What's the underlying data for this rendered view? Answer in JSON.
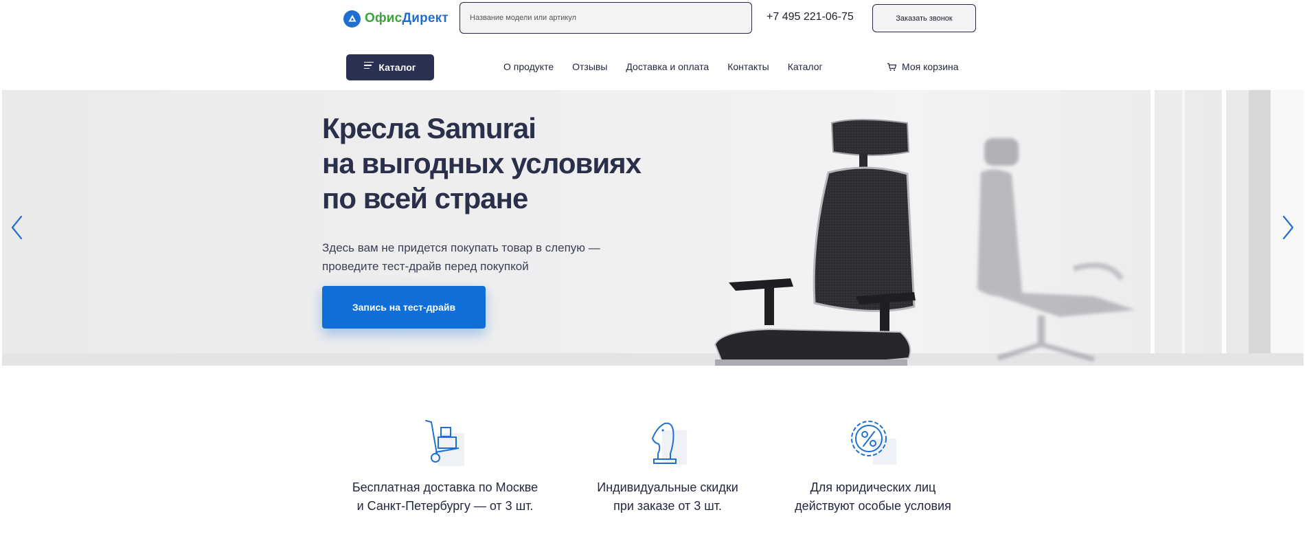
{
  "header": {
    "logo_part1": "Офис",
    "logo_part2": "Директ",
    "search_placeholder": "Название модели или артикул",
    "phone": "+7 495 221-06-75",
    "callback_label": "Заказать звонок"
  },
  "navbar": {
    "catalog_label": "Каталог",
    "links": [
      "О продукте",
      "Отзывы",
      "Доставка и оплата",
      "Контакты",
      "Каталог"
    ],
    "cart_label": "Моя корзина"
  },
  "hero": {
    "title_lines": [
      "Кресла Samurai",
      "на выгодных условиях",
      "по всей стране"
    ],
    "subtitle_lines": [
      "Здесь вам не придется покупать товар в слепую —",
      "проведите тест-драйв перед покупкой"
    ],
    "cta_label": "Запись на тест-драйв"
  },
  "features": [
    {
      "icon": "delivery-cart-icon",
      "lines": [
        "Бесплатная доставка по Москве",
        "и Санкт-Петербургу — от 3 шт."
      ]
    },
    {
      "icon": "chess-knight-icon",
      "lines": [
        "Индивидуальные скидки",
        "при заказе от 3 шт."
      ]
    },
    {
      "icon": "percent-badge-icon",
      "lines": [
        "Для юридических лиц",
        "действуют особые условия"
      ]
    }
  ],
  "colors": {
    "brand_blue": "#1f6fd0",
    "brand_green": "#3ba33c",
    "navy": "#2b3152",
    "cta_blue": "#0f6ed7"
  }
}
